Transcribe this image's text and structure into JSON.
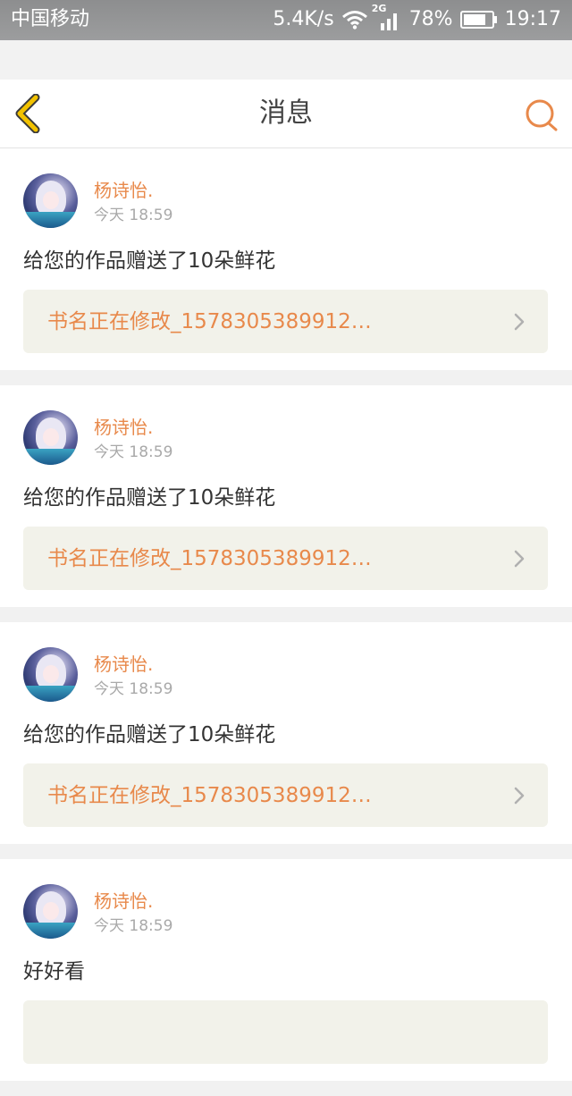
{
  "status_bar": {
    "carrier": "中国移动",
    "net_speed": "5.4K/s",
    "network_type": "2G",
    "battery": "78%",
    "time": "19:17"
  },
  "header": {
    "title": "消息",
    "back_icon": "chevron-left-icon",
    "search_icon": "search-icon"
  },
  "colors": {
    "accent": "#e8894b",
    "back_icon": "#f2c200",
    "card_bg": "#ffffff",
    "book_bg": "#f2f2ea"
  },
  "messages": [
    {
      "name": "杨诗怡.",
      "time": "今天 18:59",
      "text": "给您的作品赠送了10朵鲜花",
      "book_title": "书名正在修改_1578305389912…"
    },
    {
      "name": "杨诗怡.",
      "time": "今天 18:59",
      "text": "给您的作品赠送了10朵鲜花",
      "book_title": "书名正在修改_1578305389912…"
    },
    {
      "name": "杨诗怡.",
      "time": "今天 18:59",
      "text": "给您的作品赠送了10朵鲜花",
      "book_title": "书名正在修改_1578305389912…"
    },
    {
      "name": "杨诗怡.",
      "time": "今天 18:59",
      "text": "好好看",
      "book_title": ""
    }
  ]
}
